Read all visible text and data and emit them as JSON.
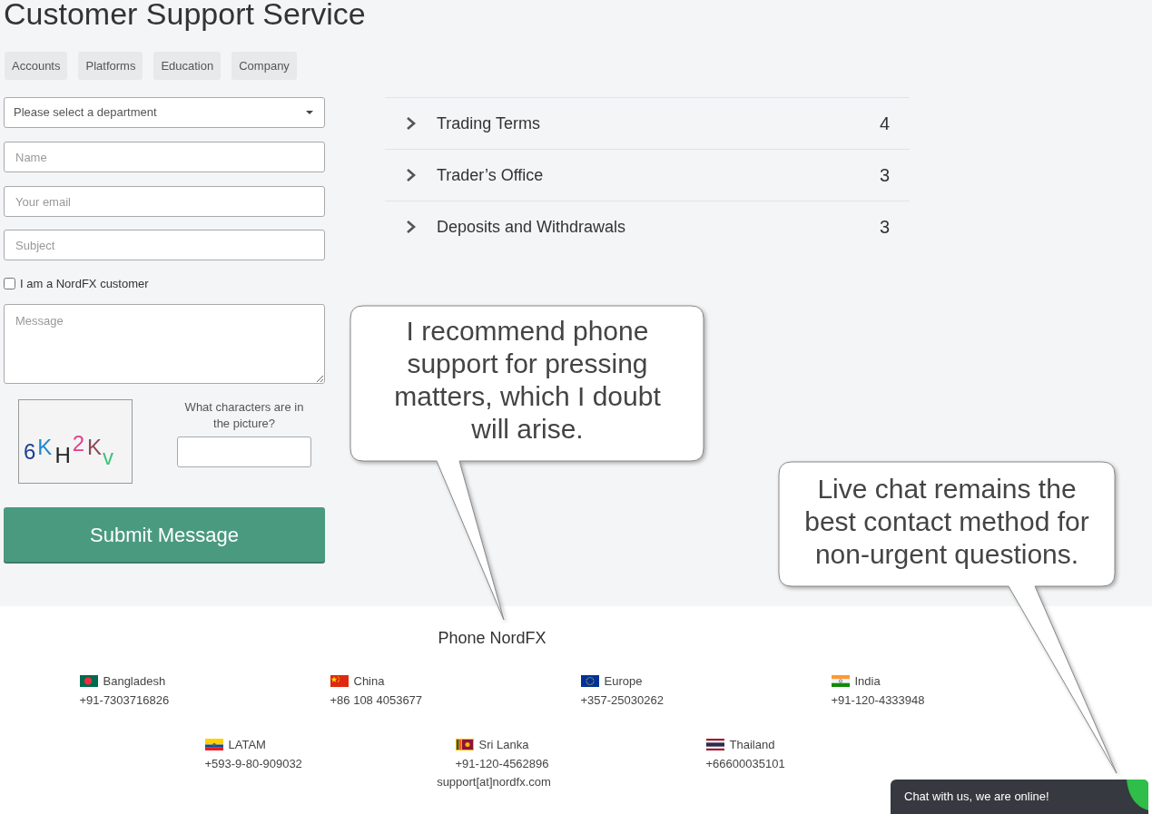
{
  "page": {
    "title": "Customer Support Service"
  },
  "categories": [
    "Accounts",
    "Platforms",
    "Education",
    "Company"
  ],
  "form": {
    "department_select": {
      "placeholder": "Please select a department"
    },
    "name_field": {
      "placeholder": "Name"
    },
    "email_field": {
      "placeholder": "Your email"
    },
    "subject_field": {
      "placeholder": "Subject"
    },
    "customer_checkbox": {
      "label": "I am a NordFX customer",
      "checked": false
    },
    "message_field": {
      "placeholder": "Message"
    },
    "captcha": {
      "characters": "6KH2Kv",
      "question": "What characters are in the picture?"
    },
    "submit": "Submit Message"
  },
  "faq": [
    {
      "title": "Trading Terms",
      "count": "4",
      "expanded": false
    },
    {
      "title": "Trader’s Office",
      "count": "3",
      "expanded": false
    },
    {
      "title": "Deposits and Withdrawals",
      "count": "3",
      "expanded": false
    }
  ],
  "callouts": [
    {
      "text": "I recommend phone support for pressing matters, which I doubt will arise."
    },
    {
      "text": "Live chat remains the best contact method for non-urgent questions."
    }
  ],
  "footer": {
    "heading": "Phone NordFX",
    "phones": [
      {
        "country": "Bangladesh",
        "number": "+91-7303716826"
      },
      {
        "country": "China",
        "number": "+86 108 4053677"
      },
      {
        "country": "Europe",
        "number": "+357-25030262"
      },
      {
        "country": "India",
        "number": "+91-120-4333948"
      },
      {
        "country": "LATAM",
        "number": "+593-9-80-909032"
      },
      {
        "country": "Sri Lanka",
        "number": "+91-120-4562896"
      },
      {
        "country": "Thailand",
        "number": "+66600035101"
      }
    ],
    "email": "support[at]nordfx.com"
  },
  "chat_widget": {
    "label": "Chat with us, we are online!"
  }
}
